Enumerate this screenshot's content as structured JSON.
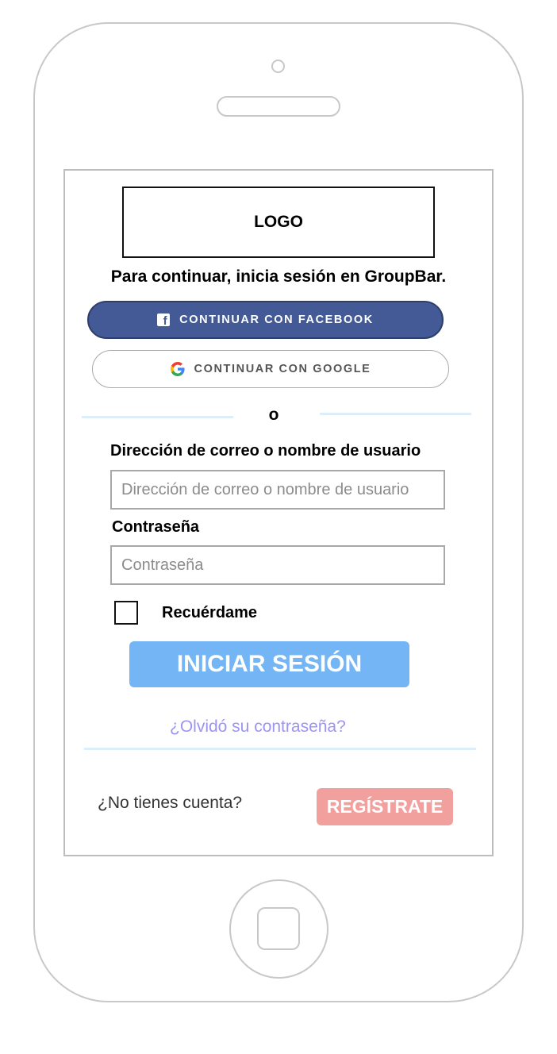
{
  "logo": {
    "text": "LOGO"
  },
  "headline": "Para continuar, inicia sesión en GroupBar.",
  "social": {
    "facebook_label": "CONTINUAR CON FACEBOOK",
    "google_label": "CONTINUAR CON GOOGLE",
    "facebook_color": "#435a96"
  },
  "separator": {
    "text": "o"
  },
  "form": {
    "email_label": "Dirección de correo o nombre de usuario",
    "email_placeholder": "Dirección de correo o nombre de usuario",
    "email_value": "",
    "password_label": "Contraseña",
    "password_placeholder": "Contraseña",
    "password_value": "",
    "remember_label": "Recuérdame",
    "remember_checked": false,
    "submit_label": "INICIAR SESIÓN",
    "submit_color": "#74b6f5"
  },
  "forgot_password": "¿Olvidó su contraseña?",
  "signup": {
    "prompt": "¿No tienes cuenta?",
    "button_label": "REGÍSTRATE",
    "button_color": "#f2a09e"
  },
  "icons": {
    "facebook": "facebook-icon",
    "google": "google-icon",
    "home": "home-button"
  }
}
